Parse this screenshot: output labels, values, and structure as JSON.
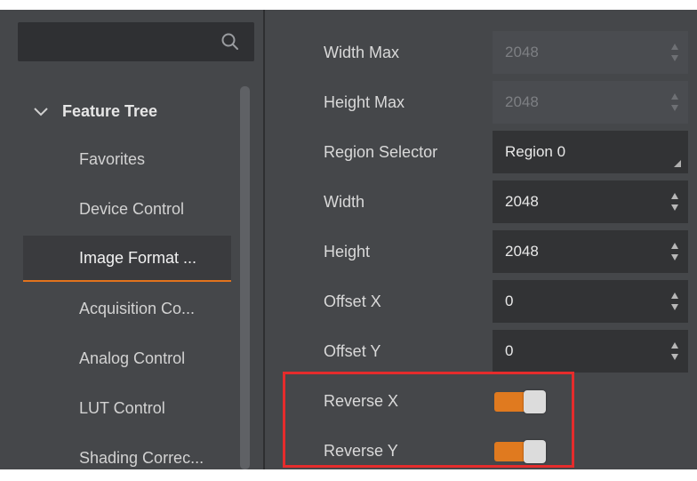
{
  "search": {
    "placeholder": ""
  },
  "feature_tree": {
    "header_label": "Feature Tree",
    "items": [
      {
        "label": "Favorites",
        "selected": false
      },
      {
        "label": "Device Control",
        "selected": false
      },
      {
        "label": "Image Format ...",
        "selected": true
      },
      {
        "label": "Acquisition Co...",
        "selected": false
      },
      {
        "label": "Analog Control",
        "selected": false
      },
      {
        "label": "LUT Control",
        "selected": false
      },
      {
        "label": "Shading Correc...",
        "selected": false
      }
    ]
  },
  "properties": [
    {
      "label": "Width Max",
      "value": "2048",
      "kind": "spin",
      "disabled": true
    },
    {
      "label": "Height Max",
      "value": "2048",
      "kind": "spin",
      "disabled": true
    },
    {
      "label": "Region Selector",
      "value": "Region 0",
      "kind": "combo",
      "disabled": false
    },
    {
      "label": "Width",
      "value": "2048",
      "kind": "spin",
      "disabled": false
    },
    {
      "label": "Height",
      "value": "2048",
      "kind": "spin",
      "disabled": false
    },
    {
      "label": "Offset X",
      "value": "0",
      "kind": "spin",
      "disabled": false
    },
    {
      "label": "Offset Y",
      "value": "0",
      "kind": "spin",
      "disabled": false
    },
    {
      "label": "Reverse X",
      "value": true,
      "kind": "toggle",
      "disabled": false
    },
    {
      "label": "Reverse Y",
      "value": true,
      "kind": "toggle",
      "disabled": false
    }
  ],
  "colors": {
    "accent": "#e07a1f",
    "highlight": "#e52c2c",
    "panel_bg": "#45474a"
  }
}
